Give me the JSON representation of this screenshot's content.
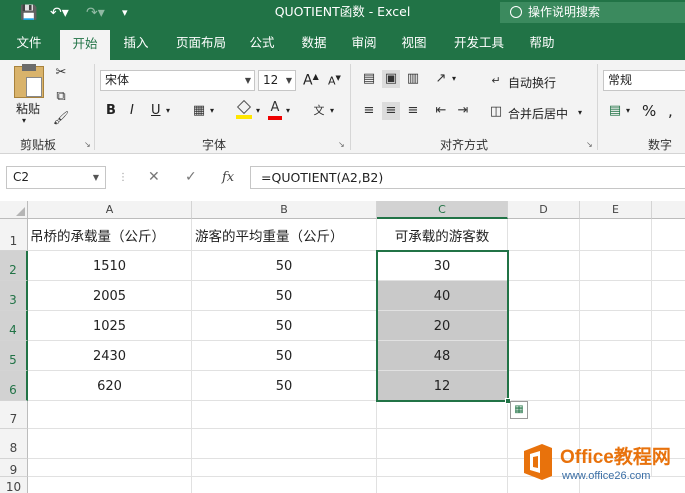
{
  "window": {
    "title": "QUOTIENT函数  -  Excel",
    "tell_me": "操作说明搜索"
  },
  "ribbon_tabs": [
    "文件",
    "开始",
    "插入",
    "页面布局",
    "公式",
    "数据",
    "审阅",
    "视图",
    "开发工具",
    "帮助"
  ],
  "active_tab": "开始",
  "ribbon": {
    "clipboard": {
      "paste_label": "粘贴",
      "group_label": "剪贴板"
    },
    "font": {
      "font_name": "宋体",
      "font_size": "12",
      "bold": "B",
      "italic": "I",
      "underline": "U",
      "grow_font": "A",
      "shrink_font": "A",
      "font_color_letter": "A",
      "group_label": "字体"
    },
    "alignment": {
      "wrap_text": "自动换行",
      "merge_center": "合并后居中",
      "group_label": "对齐方式"
    },
    "number": {
      "format": "常规",
      "percent": "%",
      "group_label": "数字"
    }
  },
  "formula_bar": {
    "name_box": "C2",
    "fx": "fx",
    "formula": "=QUOTIENT(A2,B2)"
  },
  "sheet": {
    "columns": [
      "A",
      "B",
      "C",
      "D",
      "E"
    ],
    "rows": [
      "1",
      "2",
      "3",
      "4",
      "5",
      "6",
      "7",
      "8",
      "9",
      "10"
    ],
    "headers": [
      "吊桥的承载量（公斤）",
      "游客的平均重量（公斤）",
      "可承载的游客数"
    ],
    "data": [
      [
        "1510",
        "50",
        "30"
      ],
      [
        "2005",
        "50",
        "40"
      ],
      [
        "1025",
        "50",
        "20"
      ],
      [
        "2430",
        "50",
        "48"
      ],
      [
        "620",
        "50",
        "12"
      ]
    ],
    "selected_range": "C2:C6"
  },
  "watermark": {
    "brand": "Office教程网",
    "url": "www.office26.com"
  },
  "colors": {
    "excel_green": "#217346",
    "selection_gray": "#c9c9c9",
    "watermark_orange": "#e8720c"
  }
}
